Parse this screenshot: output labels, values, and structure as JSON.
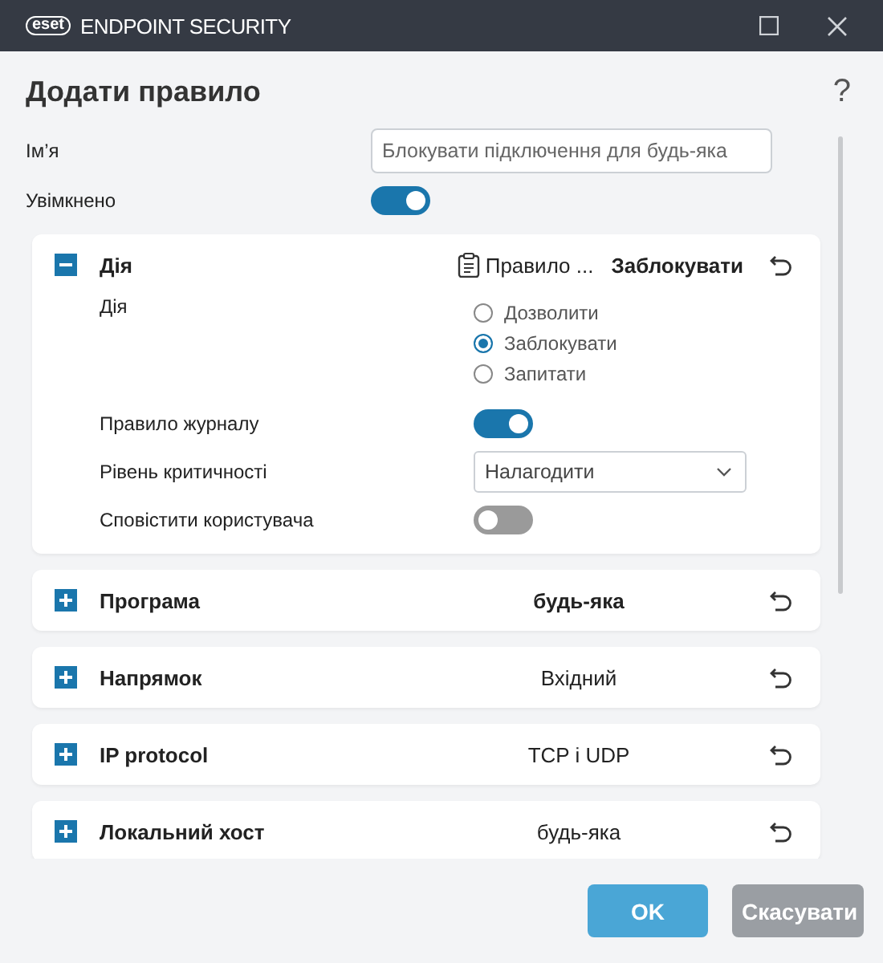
{
  "window": {
    "brand": "eset",
    "product": "ENDPOINT SECURITY"
  },
  "dialog": {
    "title": "Додати правило",
    "help": "?"
  },
  "name": {
    "label": "Ім’я",
    "value": "Блокувати підключення для будь-яка"
  },
  "enabled": {
    "label": "Увімкнено",
    "on": true
  },
  "sections": [
    {
      "title": "Дія",
      "expanded": true,
      "note": "Правило ...",
      "value": "Заблокувати",
      "bold_value": true,
      "fields": [
        {
          "kind": "radio",
          "label": "Дія",
          "options": [
            {
              "label": "Дозволити",
              "selected": false
            },
            {
              "label": "Заблокувати",
              "selected": true
            },
            {
              "label": "Запитати",
              "selected": false
            }
          ]
        },
        {
          "kind": "toggle",
          "label": "Правило журналу",
          "on": true
        },
        {
          "kind": "select",
          "label": "Рівень критичності",
          "value": "Налагодити"
        },
        {
          "kind": "toggle",
          "label": "Сповістити користувача",
          "on": false
        }
      ]
    },
    {
      "title": "Програма",
      "expanded": false,
      "value": "будь-яка",
      "bold_value": true
    },
    {
      "title": "Напрямок",
      "expanded": false,
      "value": "Вхідний",
      "bold_value": false
    },
    {
      "title": "IP protocol",
      "expanded": false,
      "value": "TCP і UDP",
      "bold_value": false
    },
    {
      "title": "Локальний хост",
      "expanded": false,
      "value": "будь-яка",
      "bold_value": false
    }
  ],
  "buttons": [
    {
      "label": "OK",
      "kind": "primary"
    },
    {
      "label": "Скасувати",
      "kind": "secondary"
    }
  ]
}
